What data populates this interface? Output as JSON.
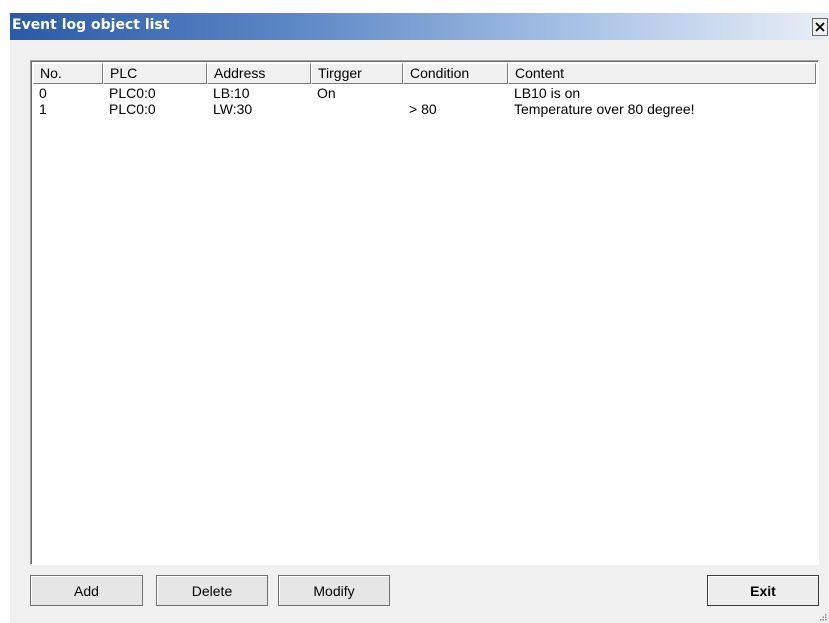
{
  "window": {
    "title": "Event log object list"
  },
  "list": {
    "columns": [
      "No.",
      "PLC",
      "Address",
      "Tirgger",
      "Condition",
      "Content"
    ],
    "rows": [
      [
        "0",
        "PLC0:0",
        "LB:10",
        "On",
        "",
        "LB10 is on"
      ],
      [
        "1",
        "PLC0:0",
        "LW:30",
        "",
        "> 80",
        "Temperature over 80 degree!"
      ]
    ]
  },
  "buttons": {
    "add": "Add",
    "delete": "Delete",
    "modify": "Modify",
    "exit": "Exit"
  },
  "icons": {
    "close": "close-icon",
    "grip": "resize-grip-icon"
  }
}
